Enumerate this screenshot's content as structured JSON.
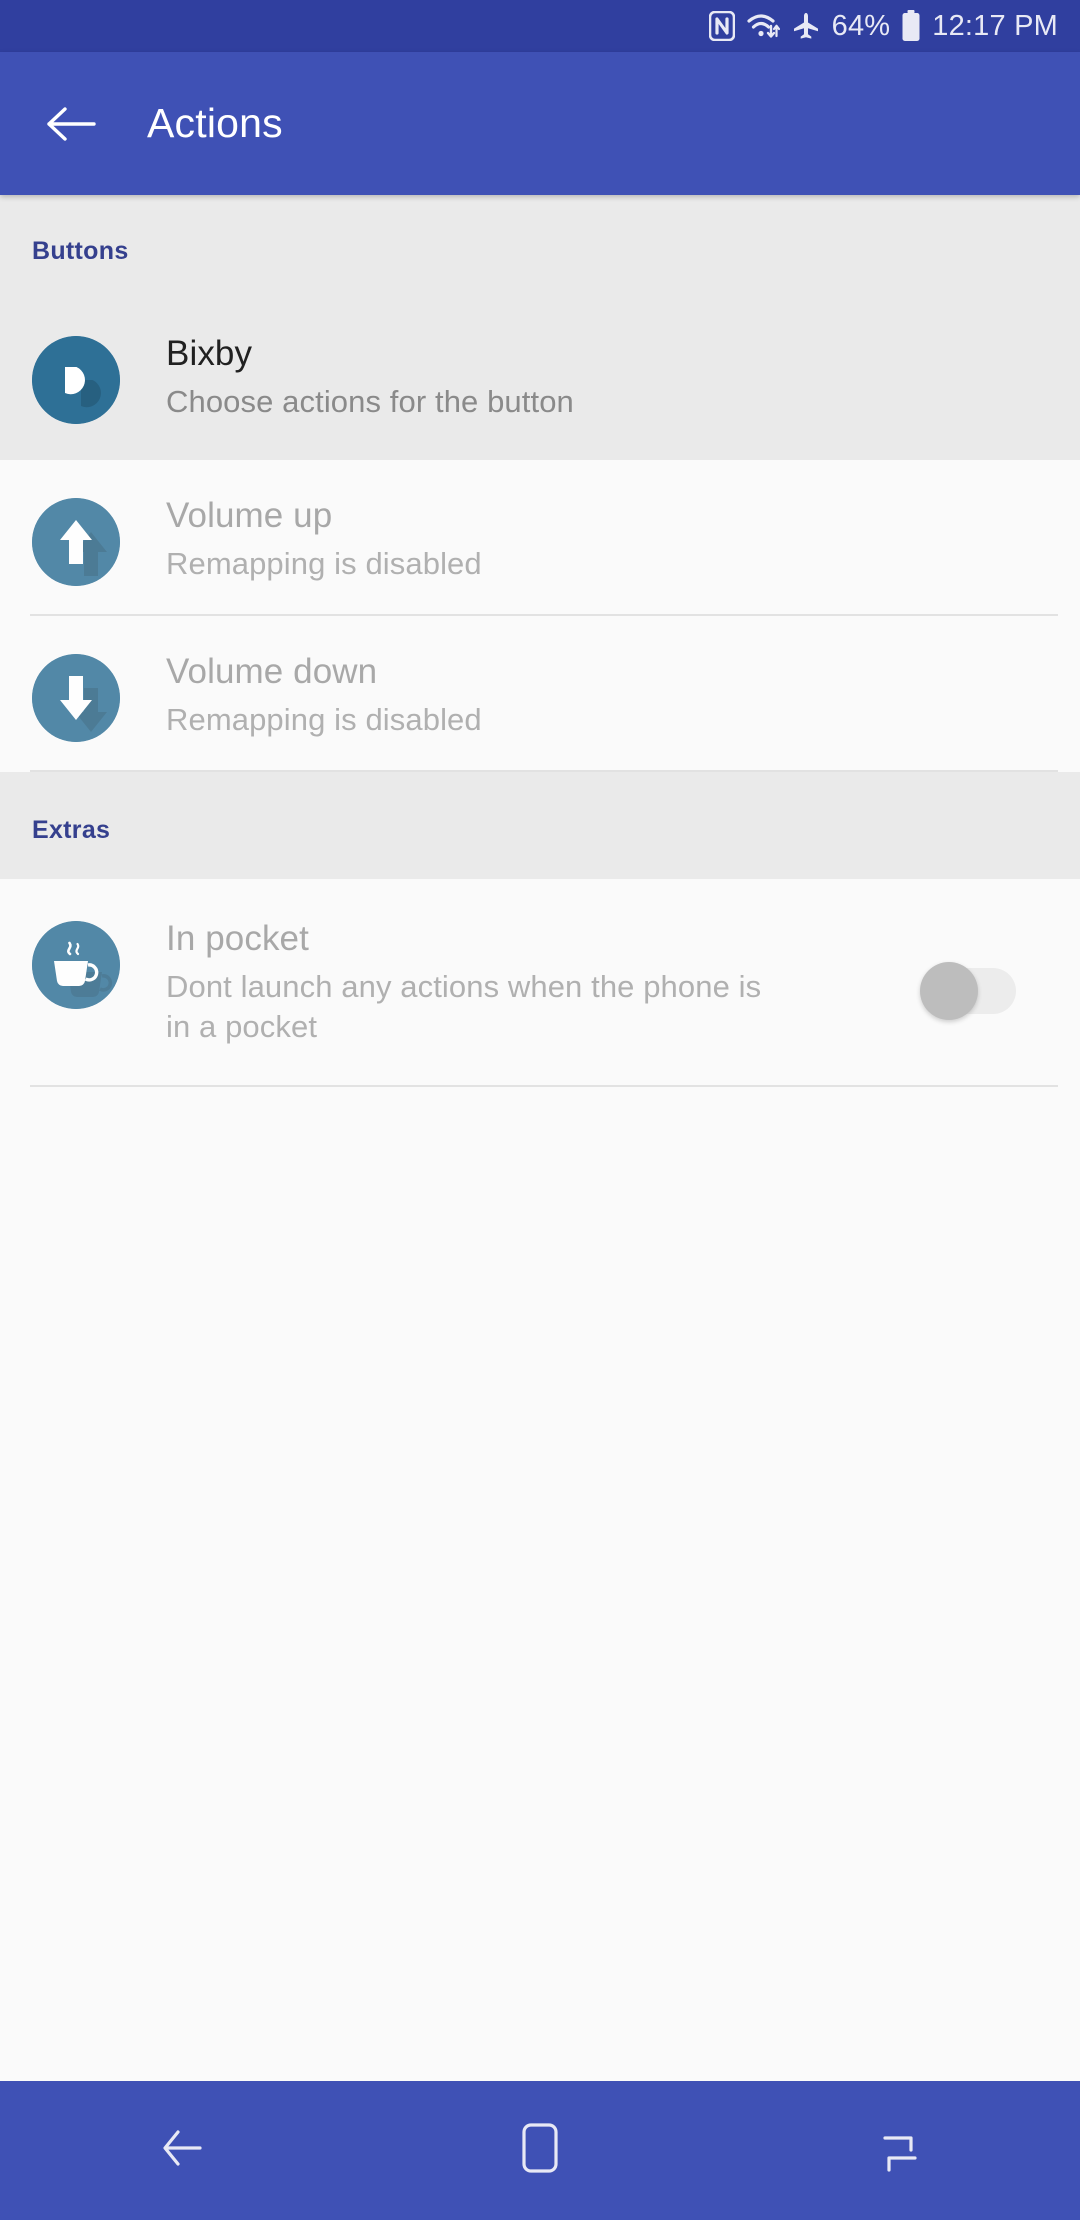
{
  "status_bar": {
    "battery_percent": "64%",
    "time": "12:17 PM",
    "icons": [
      "nfc-icon",
      "wifi-icon",
      "airplane-mode-icon",
      "battery-icon"
    ]
  },
  "toolbar": {
    "title": "Actions",
    "back_icon": "back-arrow-icon"
  },
  "sections": [
    {
      "header": "Buttons",
      "rows": [
        {
          "title": "Bixby",
          "subtitle": "Choose actions for the button",
          "icon": "bixby-teardrop-icon",
          "state": "enabled",
          "highlighted": true
        },
        {
          "title": "Volume up",
          "subtitle": "Remapping is disabled",
          "icon": "arrow-up-icon",
          "state": "disabled",
          "highlighted": false
        },
        {
          "title": "Volume down",
          "subtitle": "Remapping is disabled",
          "icon": "arrow-down-icon",
          "state": "disabled",
          "highlighted": false
        }
      ]
    },
    {
      "header": "Extras",
      "rows": [
        {
          "title": "In pocket",
          "subtitle": "Dont launch any actions when the phone is in a pocket",
          "icon": "coffee-cup-icon",
          "state": "disabled",
          "highlighted": false,
          "toggle": "off"
        }
      ]
    }
  ],
  "nav_bar": {
    "back_label": "back-icon",
    "home_label": "home-icon",
    "recents_label": "recents-icon"
  },
  "colors": {
    "status_bar": "#303F9F",
    "toolbar": "#3F51B5",
    "section_header_text": "#35408E",
    "icon_circle": "#2E7096",
    "row_bg": "#FAFAFA",
    "row_bg_highlighted": "#EAEAEA"
  }
}
